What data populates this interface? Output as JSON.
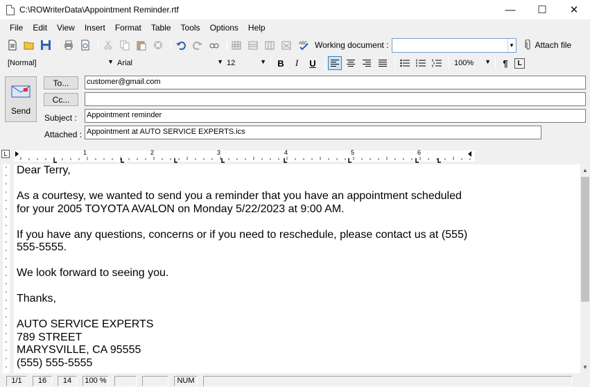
{
  "window": {
    "title": "C:\\ROWriterData\\Appointment Reminder.rtf",
    "minimize": "—",
    "maximize": "☐",
    "close": "✕"
  },
  "menu": [
    "File",
    "Edit",
    "View",
    "Insert",
    "Format",
    "Table",
    "Tools",
    "Options",
    "Help"
  ],
  "toolbar": {
    "working_document_label": "Working document :",
    "working_document_value": "",
    "attach_file_label": "Attach file"
  },
  "format_bar": {
    "style": "[Normal]",
    "font": "Arial",
    "size": "12",
    "zoom": "100%",
    "bold": "B",
    "italic": "I",
    "underline": "U",
    "pilcrow": "¶",
    "active_alignment": "left"
  },
  "email": {
    "send_label": "Send",
    "to_button": "To...",
    "cc_button": "Cc...",
    "subject_label": "Subject :",
    "attached_label": "Attached :",
    "to_value": "customer@gmail.com",
    "cc_value": "",
    "subject_value": "Appointment reminder",
    "attached_value": "Appointment at AUTO SERVICE EXPERTS.ics"
  },
  "ruler": {
    "corner": "L",
    "numbers": [
      "1",
      "2",
      "3",
      "4",
      "5",
      "6"
    ]
  },
  "document": {
    "lines": [
      "Dear Terry,",
      "",
      "As a courtesy, we wanted to send you a reminder that you have an appointment scheduled",
      "for your 2005 TOYOTA AVALON on Monday 5/22/2023 at 9:00 AM.",
      "",
      "If you have any questions, concerns or if you need to reschedule, please contact us at (555)",
      "555-5555.",
      "",
      "We look forward to seeing you.",
      "",
      "Thanks,",
      "",
      "AUTO SERVICE EXPERTS",
      "789 STREET",
      "MARYSVILLE, CA 95555",
      "(555) 555-5555"
    ]
  },
  "status": {
    "page": "1/1",
    "line": "16",
    "column": "14",
    "zoom": "100 %",
    "blank1": "",
    "blank2": "",
    "num": "NUM",
    "blank3": ""
  }
}
